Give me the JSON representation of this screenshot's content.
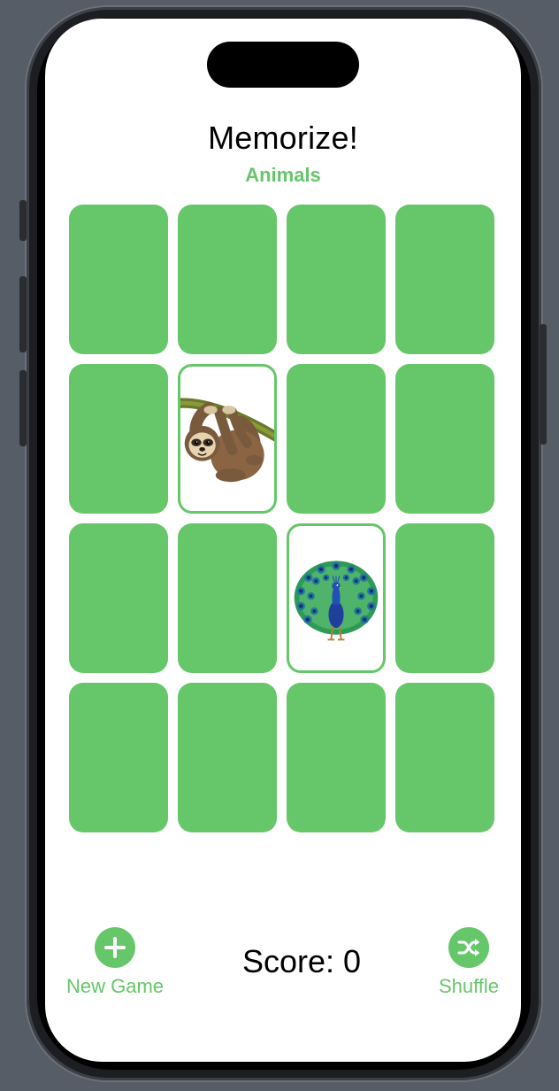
{
  "app": {
    "title": "Memorize!",
    "theme_name": "Animals",
    "accent_color": "#66c66a"
  },
  "cards": [
    {
      "face_up": false,
      "content": ""
    },
    {
      "face_up": false,
      "content": ""
    },
    {
      "face_up": false,
      "content": ""
    },
    {
      "face_up": false,
      "content": ""
    },
    {
      "face_up": false,
      "content": ""
    },
    {
      "face_up": true,
      "content": "sloth-icon"
    },
    {
      "face_up": false,
      "content": ""
    },
    {
      "face_up": false,
      "content": ""
    },
    {
      "face_up": false,
      "content": ""
    },
    {
      "face_up": false,
      "content": ""
    },
    {
      "face_up": true,
      "content": "peacock-icon"
    },
    {
      "face_up": false,
      "content": ""
    },
    {
      "face_up": false,
      "content": ""
    },
    {
      "face_up": false,
      "content": ""
    },
    {
      "face_up": false,
      "content": ""
    },
    {
      "face_up": false,
      "content": ""
    }
  ],
  "footer": {
    "new_game_label": "New Game",
    "new_game_icon": "plus-icon",
    "score_text": "Score: 0",
    "shuffle_label": "Shuffle",
    "shuffle_icon": "shuffle-icon"
  }
}
